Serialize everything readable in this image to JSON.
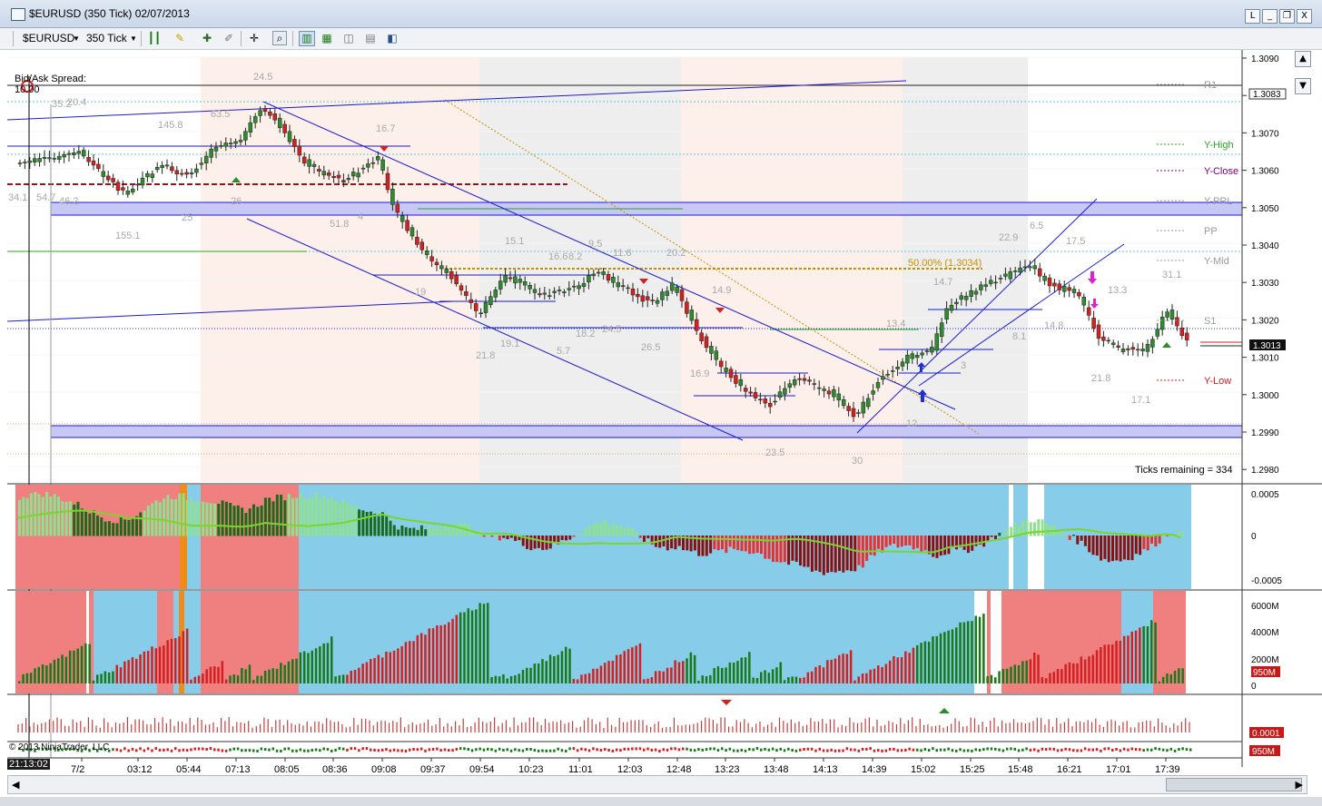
{
  "window": {
    "title": "$EURUSD (350 Tick)  02/07/2013",
    "controls": [
      "L",
      "_",
      "❐",
      "X"
    ]
  },
  "toolbar": {
    "instrument": "$EURUSD",
    "interval": "350 Tick",
    "icons": [
      "bar-type-icon",
      "draw-icon",
      "plus-icon",
      "pen-icon",
      "crosshair-icon",
      "zoom-icon",
      "chart-style-icon",
      "indicators-icon",
      "strategy-icon",
      "properties-icon",
      "template-icon"
    ]
  },
  "price_axis": {
    "labels": [
      "1.3090",
      "1.3080",
      "1.3070",
      "1.3060",
      "1.3050",
      "1.3040",
      "1.3030",
      "1.3020",
      "1.3010",
      "1.3000",
      "1.2990",
      "1.2980"
    ],
    "ask_tag": "1.3083",
    "last_tag": "1.3013"
  },
  "pivot_labels": [
    {
      "text": "R1",
      "color": "#999999"
    },
    {
      "text": "Y-High",
      "color": "#2aa52a"
    },
    {
      "text": "Y-Close",
      "color": "#800080"
    },
    {
      "text": "Y-PRL",
      "color": "#999999"
    },
    {
      "text": "PP",
      "color": "#999999"
    },
    {
      "text": "Y-Mid",
      "color": "#999999"
    },
    {
      "text": "S1",
      "color": "#999999"
    },
    {
      "text": "Y-Low",
      "color": "#d11a1a"
    }
  ],
  "annotations": {
    "bid_ask_label": "Bid/Ask Spread:",
    "bid_ask_value": "10.00",
    "fib": "50.00% (1.3034)",
    "ticks_remaining": "Ticks remaining = 334",
    "copyright": "© 2013 NinjaTrader, LLC",
    "swing_values": [
      "24.5",
      "35.2",
      "20.4",
      "63.5",
      "145.8",
      "16.7",
      "34.1",
      "54.7",
      "46.2",
      "26",
      "25",
      "51.8",
      "4",
      "155.1",
      "15.1",
      "16.6",
      "8.2",
      "9.5",
      "11.6",
      "20.2",
      "19",
      "18.2",
      "24.5",
      "26.5",
      "21.8",
      "19.1",
      "5.7",
      "14.9",
      "16.9",
      "23.5",
      "30",
      "12",
      "13.4",
      "14.7",
      "22.9",
      "6.5",
      "17.5",
      "14.8",
      "8.1",
      "13.3",
      "31.1",
      "21.8",
      "17.1",
      "3"
    ]
  },
  "indicator_panels": {
    "macd_axis": [
      "0.0005",
      "0",
      "-0.0005"
    ],
    "volume_axis": [
      "6000M",
      "4000M",
      "2000M",
      "0"
    ],
    "volume_tag": "950M",
    "tick_tag": "0.0001",
    "bottom_tag": "950M"
  },
  "time_axis": {
    "current_time": "21:13:02",
    "labels": [
      "7/2",
      "03:12",
      "05:44",
      "07:13",
      "08:05",
      "08:36",
      "09:08",
      "09:37",
      "09:54",
      "10:23",
      "11:01",
      "12:03",
      "12:48",
      "13:23",
      "13:48",
      "14:13",
      "14:39",
      "15:02",
      "15:25",
      "15:48",
      "16:21",
      "17:01",
      "17:39"
    ]
  },
  "colors": {
    "up_candle": "#2e8b2e",
    "down_candle": "#d42020",
    "channel": "#1a1ad6",
    "panel_blue": "#87cdea",
    "panel_red": "#f08080",
    "session_pink": "#fdefe8",
    "session_gray": "#ececec"
  }
}
